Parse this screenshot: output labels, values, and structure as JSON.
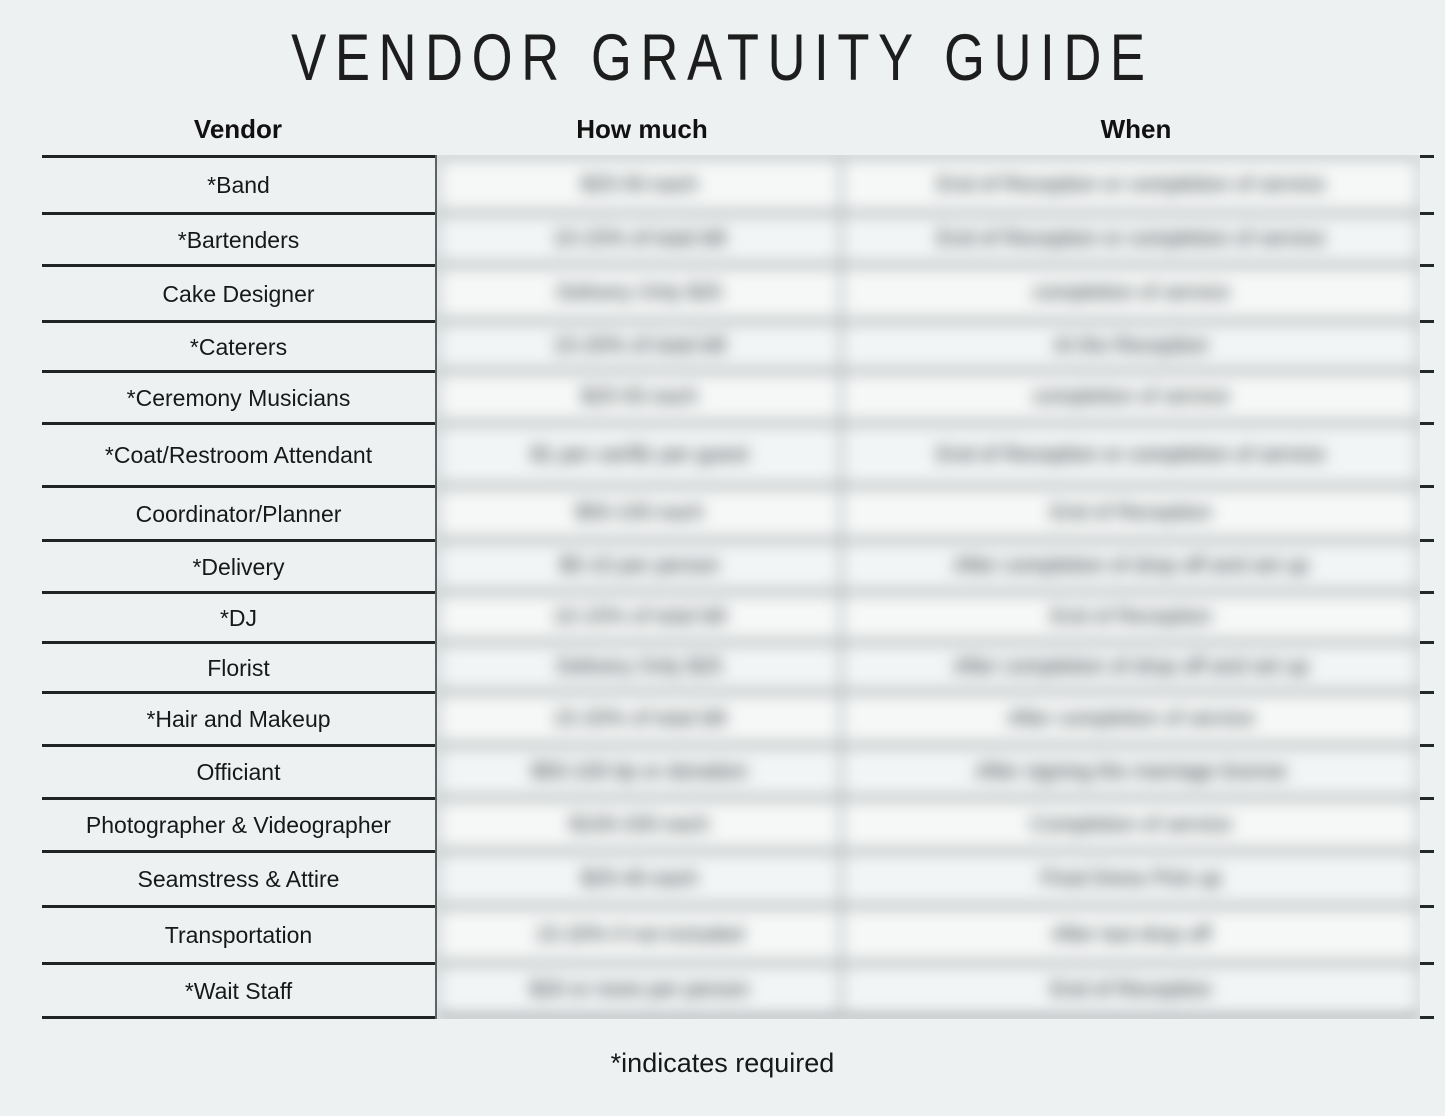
{
  "title": "VENDOR GRATUITY GUIDE",
  "footer_note": "*indicates required",
  "colors": {
    "background": "#edf1f2",
    "text": "#15191a",
    "rule": "#202425",
    "blur_panel": "#f4f7f7"
  },
  "table": {
    "headers": {
      "vendor": "Vendor",
      "how_much": "How much",
      "when": "When"
    },
    "columns": [
      "Vendor",
      "How much",
      "When"
    ],
    "rows": [
      {
        "vendor": "*Band",
        "how_much": "$25-50 each",
        "when": "End of Reception or completion of service"
      },
      {
        "vendor": "*Bartenders",
        "how_much": "10-15% of total bill",
        "when": "End of Reception or completion of service"
      },
      {
        "vendor": "Cake Designer",
        "how_much": "Delivery Only $25",
        "when": "completion of service"
      },
      {
        "vendor": "*Caterers",
        "how_much": "15-20% of total bill",
        "when": "At the Reception"
      },
      {
        "vendor": "*Ceremony Musicians",
        "how_much": "$25-50 each",
        "when": "completion of service"
      },
      {
        "vendor": "*Coat/Restroom Attendant",
        "how_much": "$1 per car/$1 per guest",
        "when": "End of Reception or completion of service"
      },
      {
        "vendor": "Coordinator/Planner",
        "how_much": "$50-100 each",
        "when": "End of Reception"
      },
      {
        "vendor": "*Delivery",
        "how_much": "$5-10 per person",
        "when": "After completion of drop off and set up"
      },
      {
        "vendor": "*DJ",
        "how_much": "10-15% of total bill",
        "when": "End of Reception"
      },
      {
        "vendor": "Florist",
        "how_much": "Delivery Only $25",
        "when": "After completion of drop off and set up"
      },
      {
        "vendor": "*Hair and Makeup",
        "how_much": "15-20% of total bill",
        "when": "After completion of service"
      },
      {
        "vendor": "Officiant",
        "how_much": "$50-100 tip or donation",
        "when": "After signing the marriage license"
      },
      {
        "vendor": "Photographer & Videographer",
        "how_much": "$100-200 each",
        "when": "Completion of service"
      },
      {
        "vendor": "Seamstress & Attire",
        "how_much": "$25-40  each",
        "when": "Final Dress Pick up"
      },
      {
        "vendor": "Transportation",
        "how_much": "15-20% if not included",
        "when": "After last drop off"
      },
      {
        "vendor": "*Wait Staff",
        "how_much": "$20 or more per person",
        "when": "End of Reception"
      }
    ]
  }
}
